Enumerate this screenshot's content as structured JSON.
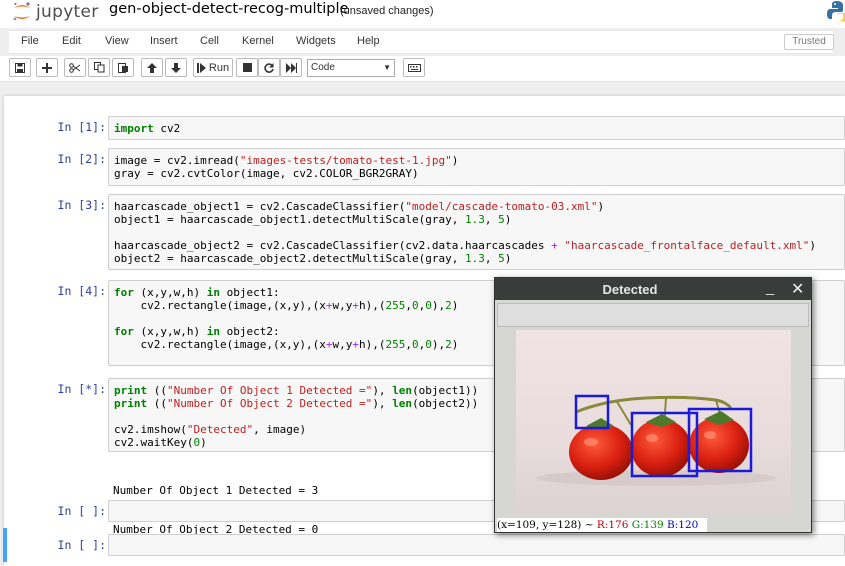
{
  "header": {
    "logo_text": "jupyter",
    "notebook_name": "gen-object-detect-recog-multiple",
    "save_status": "(unsaved changes)"
  },
  "menubar": {
    "items": [
      "File",
      "Edit",
      "View",
      "Insert",
      "Cell",
      "Kernel",
      "Widgets",
      "Help"
    ],
    "trusted": "Trusted"
  },
  "toolbar": {
    "run_label": "Run",
    "cell_type": "Code",
    "buttons": [
      "save-icon",
      "plus-icon",
      "cut-icon",
      "copy-icon",
      "paste-icon",
      "arrow-up-icon",
      "arrow-down-icon",
      "run-icon",
      "stop-icon",
      "restart-icon",
      "fast-forward-icon",
      "keyboard-icon"
    ]
  },
  "cells": [
    {
      "prompt": "In [1]:",
      "lines": [
        "import cv2"
      ]
    },
    {
      "prompt": "In [2]:",
      "lines": [
        "image = cv2.imread(\"images-tests/tomato-test-1.jpg\")",
        "gray = cv2.cvtColor(image, cv2.COLOR_BGR2GRAY)"
      ]
    },
    {
      "prompt": "In [3]:",
      "lines": [
        "haarcascade_object1 = cv2.CascadeClassifier(\"model/cascade-tomato-03.xml\")",
        "object1 = haarcascade_object1.detectMultiScale(gray, 1.3, 5)",
        "",
        "haarcascade_object2 = cv2.CascadeClassifier(cv2.data.haarcascades + \"haarcascade_frontalface_default.xml\")",
        "object2 = haarcascade_object2.detectMultiScale(gray, 1.3, 5)"
      ]
    },
    {
      "prompt": "In [4]:",
      "lines": [
        "for (x,y,w,h) in object1:",
        "    cv2.rectangle(image,(x,y),(x+w,y+h),(255,0,0),2)",
        "",
        "for (x,y,w,h) in object2:",
        "    cv2.rectangle(image,(x,y),(x+w,y+h),(255,0,0),2)"
      ]
    },
    {
      "prompt": "In [*]:",
      "lines": [
        "print ((\"Number Of Object 1 Detected =\"), len(object1))",
        "print ((\"Number Of Object 2 Detected =\"), len(object2))",
        "",
        "cv2.imshow(\"Detected\", image)",
        "cv2.waitKey(0)"
      ],
      "output": [
        "Number Of Object 1 Detected = 3",
        "Number Of Object 2 Detected = 0"
      ]
    },
    {
      "prompt": "In [ ]:",
      "lines": [
        ""
      ]
    },
    {
      "prompt": "In [ ]:",
      "lines": [
        ""
      ]
    }
  ],
  "detected_window": {
    "title": "Detected",
    "status": {
      "coords": "(x=109, y=128) ~",
      "r": "R:176",
      "g": "G:139",
      "b": "B:120"
    },
    "colors": {
      "box": "#1a1ad8",
      "r": "#c00000",
      "g": "#008000",
      "b": "#0000cc"
    }
  },
  "colors": {
    "prompt": "#303f9f",
    "selected_cell_bar": "#42a5f5",
    "keyword": "#008000",
    "string": "#ba2121"
  }
}
